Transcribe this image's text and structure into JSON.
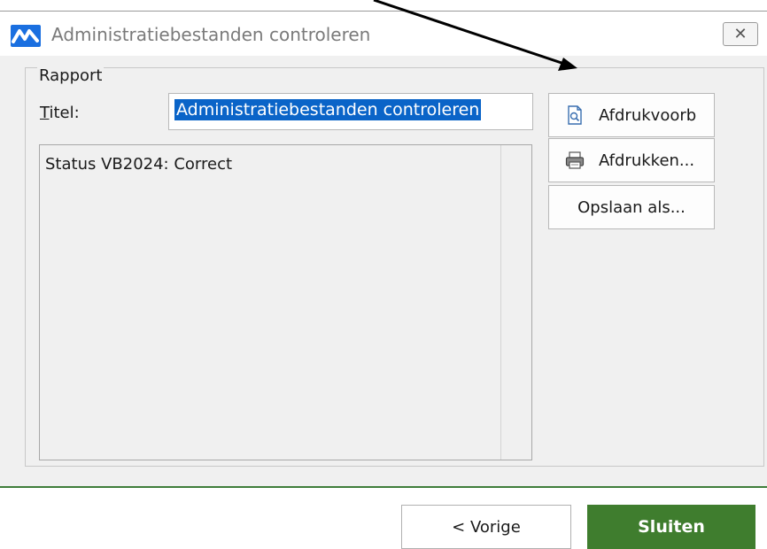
{
  "window": {
    "title": "Administratiebestanden controleren",
    "corner_text": "",
    "close_glyph": "✕"
  },
  "report": {
    "group_label": "Rapport",
    "titel_label_accel": "T",
    "titel_label_rest": "itel:",
    "titel_value": "Administratiebestanden controleren",
    "lines": [
      "Status VB2024: Correct"
    ]
  },
  "actions": {
    "preview_label": "Afdrukvoorb",
    "print_label": "Afdrukken...",
    "save_as_label": "Opslaan als..."
  },
  "footer": {
    "back_label": "< Vorige",
    "close_label": "Sluiten"
  },
  "colors": {
    "accent_blue": "#0a64c8",
    "primary_green": "#3f7d2e",
    "logo_blue": "#1a6fe0"
  },
  "icons": {
    "app_logo": "av-logo-icon",
    "preview": "print-preview-icon",
    "print": "printer-icon",
    "close": "close-icon"
  }
}
